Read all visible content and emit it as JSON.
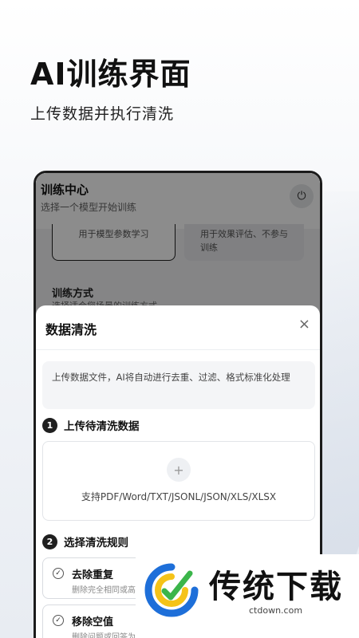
{
  "hero": {
    "title": "AI训练界面",
    "subtitle": "上传数据并执行清洗"
  },
  "app": {
    "title": "训练中心",
    "subtitle": "选择一个模型开始训练",
    "power_icon": "power-icon"
  },
  "background": {
    "card_a_text": "用于模型参数学习",
    "card_b_text": "用于效果评估、不参与训练",
    "train_mode_title": "训练方式",
    "train_mode_sub": "选择适合您场景的训练方式"
  },
  "sheet": {
    "title": "数据清洗",
    "close_label": "×",
    "description": "上传数据文件，AI将自动进行去重、过滤、格式标准化处理",
    "step1": {
      "num": "1",
      "label": "上传待清洗数据"
    },
    "upload": {
      "plus": "+",
      "types": "支持PDF/Word/TXT/JSONL/JSON/XLS/XLSX"
    },
    "step2": {
      "num": "2",
      "label": "选择清洗规则"
    },
    "rules": [
      {
        "name": "去除重复",
        "desc": "删除完全相同或高度相似"
      },
      {
        "name": "移除空值",
        "desc": "删除问题或回答为空"
      }
    ]
  },
  "watermark": {
    "text": "传统下载",
    "url": "ctdown.com"
  },
  "colors": {
    "accent_blue": "#1e6fd9",
    "accent_yellow": "#f5c318",
    "accent_green": "#3bb54a"
  }
}
